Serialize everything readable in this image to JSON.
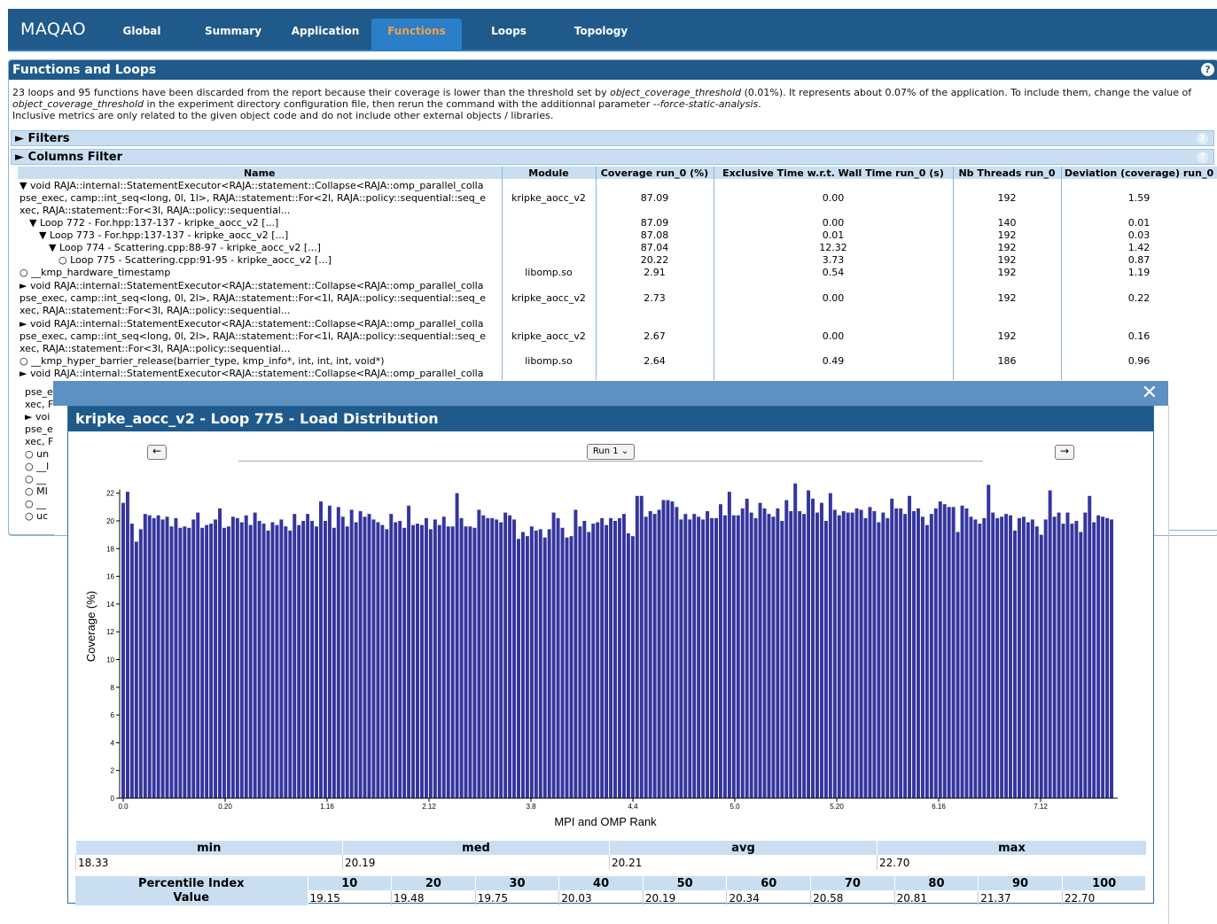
{
  "nav": {
    "logo": "MAQAO",
    "tabs": [
      "Global",
      "Summary",
      "Application",
      "Functions",
      "Loops",
      "Topology"
    ],
    "active_tab": "Functions"
  },
  "panel": {
    "title": "Functions and Loops",
    "info_line1_a": "23 loops and 95 functions have been discarded from the report because their coverage is lower than the threshold set by ",
    "info_param": "object_coverage_threshold",
    "info_line1_b": " (0.01%). It represents about 0.07% of the application. To include them, change the value of ",
    "info_line2_b": " in the experiment directory configuration file, then rerun the command with the additionnal parameter ",
    "info_flag": "--force-static-analysis",
    "info_line3": "Inclusive metrics are only related to the given object code and do not include other external objects / libraries.",
    "filters": "► Filters",
    "columns_filter": "► Columns Filter",
    "help": "?"
  },
  "table": {
    "headers": [
      "Name",
      "Module",
      "Coverage run_0 (%)",
      "Exclusive Time w.r.t. Wall Time run_0 (s)",
      "Nb Threads run_0",
      "Deviation (coverage) run_0"
    ],
    "rows": [
      {
        "name": "▼ void RAJA::internal::StatementExecutor<RAJA::statement::Collapse<RAJA::omp_parallel_colla pse_exec, camp::int_seq<long, 0l, 1l>, RAJA::statement::For<2l, RAJA::policy::sequential::seq_e xec, RAJA::statement::For<3l, RAJA::policy::sequential...",
        "module": "kripke_aocc_v2",
        "cov": "87.09",
        "time": "0.00",
        "threads": "192",
        "dev": "1.59",
        "lines": 3
      },
      {
        "name": "▼ Loop 772 - For.hpp:137-137 - kripke_aocc_v2 [...]",
        "indent": 1,
        "module": "",
        "cov": "87.09",
        "time": "0.00",
        "threads": "140",
        "dev": "0.01",
        "lines": 1
      },
      {
        "name": "▼ Loop 773 - For.hpp:137-137 - kripke_aocc_v2 [...]",
        "indent": 2,
        "module": "",
        "cov": "87.08",
        "time": "0.01",
        "threads": "192",
        "dev": "0.03",
        "lines": 1
      },
      {
        "name": "▼ Loop 774 - Scattering.cpp:88-97 - kripke_aocc_v2 [...]",
        "indent": 3,
        "module": "",
        "cov": "87.04",
        "time": "12.32",
        "threads": "192",
        "dev": "1.42",
        "lines": 1
      },
      {
        "name": "○ Loop 775 - Scattering.cpp:91-95 - kripke_aocc_v2 [...]",
        "indent": 4,
        "module": "",
        "cov": "20.22",
        "time": "3.73",
        "threads": "192",
        "dev": "0.87",
        "lines": 1
      },
      {
        "name": "○ __kmp_hardware_timestamp",
        "module": "libomp.so",
        "cov": "2.91",
        "time": "0.54",
        "threads": "192",
        "dev": "1.19",
        "lines": 1
      },
      {
        "name": "► void RAJA::internal::StatementExecutor<RAJA::statement::Collapse<RAJA::omp_parallel_colla pse_exec, camp::int_seq<long, 0l, 2l>, RAJA::statement::For<1l, RAJA::policy::sequential::seq_e xec, RAJA::statement::For<3l, RAJA::policy::sequential...",
        "module": "kripke_aocc_v2",
        "cov": "2.73",
        "time": "0.00",
        "threads": "192",
        "dev": "0.22",
        "lines": 3
      },
      {
        "name": "► void RAJA::internal::StatementExecutor<RAJA::statement::Collapse<RAJA::omp_parallel_colla pse_exec, camp::int_seq<long, 0l, 2l>, RAJA::statement::For<1l, RAJA::policy::sequential::seq_e xec, RAJA::statement::For<3l, RAJA::policy::sequential...",
        "module": "kripke_aocc_v2",
        "cov": "2.67",
        "time": "0.00",
        "threads": "192",
        "dev": "0.16",
        "lines": 3
      },
      {
        "name": "○ __kmp_hyper_barrier_release(barrier_type, kmp_info*, int, int, int, void*)",
        "module": "libomp.so",
        "cov": "2.64",
        "time": "0.49",
        "threads": "186",
        "dev": "0.96",
        "lines": 1
      },
      {
        "name": "► void RAJA::internal::StatementExecutor<RAJA::statement::Collapse<RAJA::omp_parallel_colla",
        "module": "",
        "cov": "",
        "time": "",
        "threads": "",
        "dev": "",
        "lines": 1
      }
    ],
    "hidden_fragments": [
      "pse_e",
      "xec, F",
      "► voi",
      "pse_e",
      "xec, F",
      "○ un",
      "○ __l",
      "○ __",
      "○ MI",
      "○ __",
      "○ uc"
    ]
  },
  "dialog": {
    "close": "✕",
    "title": "kripke_aocc_v2 - Loop 775 - Load Distribution",
    "prev": "←",
    "next": "→",
    "run_select": "Run 1 ⌄"
  },
  "chart_data": {
    "type": "bar",
    "title": "",
    "xlabel": "MPI and OMP Rank",
    "ylabel": "Coverage (%)",
    "ylim": [
      0,
      23
    ],
    "yticks": [
      0,
      2,
      4,
      6,
      8,
      10,
      12,
      14,
      16,
      18,
      20,
      22
    ],
    "xtick_labels": [
      "0.0",
      "0.20",
      "1.16",
      "2.12",
      "3.8",
      "4.4",
      "5.0",
      "5.20",
      "6.16",
      "7.12"
    ],
    "values": [
      21.3,
      22.1,
      19.8,
      18.5,
      19.4,
      20.5,
      20.4,
      20.2,
      20.4,
      20.1,
      20.3,
      19.6,
      20.2,
      19.5,
      19.6,
      19.5,
      20.1,
      20.6,
      19.5,
      19.7,
      19.8,
      20.1,
      20.9,
      19.5,
      19.6,
      20.3,
      20.2,
      19.9,
      20.4,
      19.7,
      20.6,
      20.0,
      19.8,
      19.3,
      19.9,
      19.7,
      20.1,
      19.6,
      19.3,
      20.5,
      19.7,
      20.0,
      20.5,
      20.0,
      19.6,
      21.4,
      20.0,
      21.1,
      19.5,
      21.0,
      20.3,
      19.6,
      20.8,
      19.9,
      20.7,
      20.3,
      20.5,
      20.1,
      19.9,
      19.7,
      19.4,
      20.5,
      19.9,
      20.0,
      19.5,
      21.1,
      19.7,
      19.8,
      19.7,
      20.2,
      19.4,
      20.1,
      19.7,
      20.3,
      19.6,
      19.6,
      22.0,
      20.2,
      19.6,
      19.6,
      19.5,
      20.8,
      20.4,
      20.2,
      20.2,
      20.1,
      19.9,
      20.6,
      20.4,
      20.1,
      18.7,
      19.2,
      18.9,
      19.6,
      19.3,
      19.4,
      18.8,
      19.4,
      20.6,
      20.2,
      19.5,
      18.8,
      18.9,
      20.8,
      19.6,
      20.0,
      19.2,
      19.8,
      19.9,
      20.2,
      19.7,
      20.2,
      20.0,
      20.2,
      20.5,
      19.1,
      18.9,
      21.8,
      21.8,
      20.3,
      20.7,
      20.5,
      20.8,
      21.5,
      21.5,
      21.4,
      21.0,
      20.1,
      20.5,
      20.1,
      20.5,
      20.3,
      20.1,
      20.7,
      20.2,
      20.2,
      21.2,
      20.4,
      22.1,
      20.4,
      20.4,
      20.9,
      21.6,
      20.6,
      20.2,
      21.3,
      20.9,
      20.5,
      20.3,
      20.9,
      20.0,
      21.5,
      20.7,
      22.7,
      20.7,
      20.5,
      22.2,
      21.6,
      20.6,
      21.3,
      20.0,
      22.0,
      20.8,
      20.4,
      20.7,
      20.6,
      20.6,
      20.9,
      20.8,
      20.2,
      21.0,
      20.7,
      19.9,
      20.6,
      20.2,
      21.6,
      20.9,
      20.9,
      20.5,
      21.8,
      20.7,
      20.9,
      20.3,
      19.7,
      20.5,
      20.9,
      21.4,
      21.2,
      21.0,
      21.0,
      19.2,
      21.1,
      20.9,
      20.3,
      20.1,
      19.8,
      20.2,
      22.6,
      20.6,
      20.2,
      20.3,
      20.5,
      20.4,
      19.3,
      20.2,
      20.3,
      19.9,
      20.1,
      19.6,
      19.0,
      20.1,
      22.2,
      20.3,
      20.6,
      19.8,
      20.6,
      19.8,
      20.0,
      19.2,
      20.6,
      21.8,
      19.9,
      20.4,
      20.3,
      20.2,
      20.1
    ],
    "color": "#35359e"
  },
  "stats": {
    "headers": [
      "min",
      "med",
      "avg",
      "max"
    ],
    "values": [
      "18.33",
      "20.19",
      "20.21",
      "22.70"
    ]
  },
  "percentiles": {
    "index_label": "Percentile Index",
    "value_label": "Value",
    "indices": [
      "10",
      "20",
      "30",
      "40",
      "50",
      "60",
      "70",
      "80",
      "90",
      "100"
    ],
    "values": [
      "19.15",
      "19.48",
      "19.75",
      "20.03",
      "20.19",
      "20.34",
      "20.58",
      "20.81",
      "21.37",
      "22.70"
    ]
  }
}
